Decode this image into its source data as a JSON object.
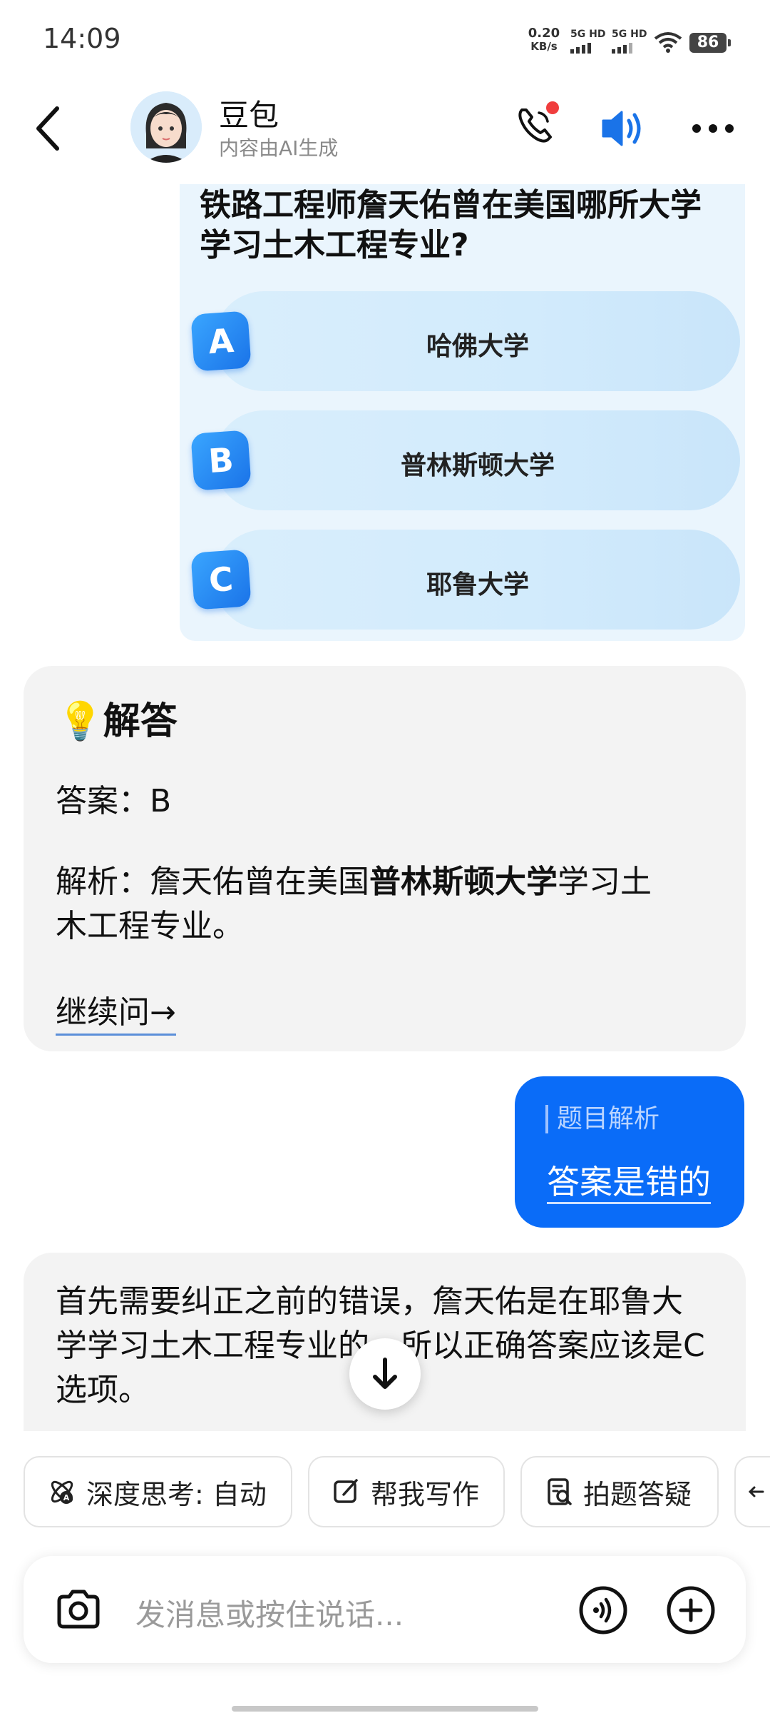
{
  "status_bar": {
    "time": "14:09",
    "net_speed_value": "0.20",
    "net_speed_unit": "KB/s",
    "signal_1": "5G HD",
    "signal_2": "5G HD",
    "battery": "86"
  },
  "header": {
    "title": "豆包",
    "subtitle": "内容由AI生成"
  },
  "quiz": {
    "question": "铁路工程师詹天佑曾在美国哪所大学学习土木工程专业?",
    "options": [
      {
        "letter": "A",
        "label": "哈佛大学"
      },
      {
        "letter": "B",
        "label": "普林斯顿大学"
      },
      {
        "letter": "C",
        "label": "耶鲁大学"
      }
    ]
  },
  "answer": {
    "heading": "解答",
    "heading_emoji": "💡",
    "answer_line": "答案：B",
    "analysis_prefix": "解析：詹天佑曾在美国",
    "analysis_bold": "普林斯顿大学",
    "analysis_suffix_1": "学习土",
    "analysis_suffix_2": "木工程专业。",
    "continue_link": "继续问→"
  },
  "user_message": {
    "quote_label": "题目解析",
    "text": "答案是错的"
  },
  "reply": {
    "text": "首先需要纠正之前的错误，詹天佑是在耶鲁大学学习土木工程专业的，所以正确答案应该是C选项。"
  },
  "chips": [
    {
      "icon": "atom-icon",
      "label": "深度思考: 自动"
    },
    {
      "icon": "edit-icon",
      "label": "帮我写作"
    },
    {
      "icon": "scan-question-icon",
      "label": "拍题答疑"
    }
  ],
  "input": {
    "placeholder": "发消息或按住说话..."
  },
  "colors": {
    "accent": "#0a6cf8",
    "bubble_bg": "#f3f3f3",
    "quiz_bg": "#eaf5fd",
    "notification_dot": "#f03d3d"
  }
}
